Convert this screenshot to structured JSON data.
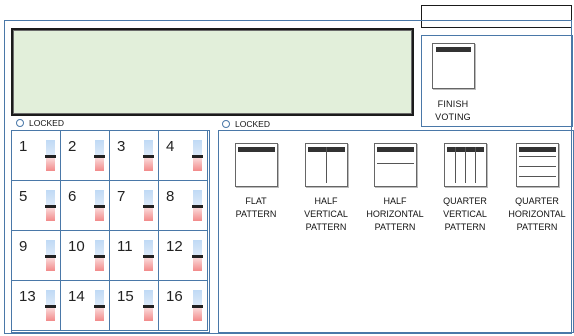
{
  "finish": {
    "label_line1": "FINISH",
    "label_line2": "VOTING"
  },
  "locks": {
    "left_label": "LOCKED",
    "right_label": "LOCKED"
  },
  "cells": [
    {
      "n": "1",
      "level": 0.55
    },
    {
      "n": "2",
      "level": 0.55
    },
    {
      "n": "3",
      "level": 0.55
    },
    {
      "n": "4",
      "level": 0.55
    },
    {
      "n": "5",
      "level": 0.55
    },
    {
      "n": "6",
      "level": 0.55
    },
    {
      "n": "7",
      "level": 0.55
    },
    {
      "n": "8",
      "level": 0.55
    },
    {
      "n": "9",
      "level": 0.55
    },
    {
      "n": "10",
      "level": 0.55
    },
    {
      "n": "11",
      "level": 0.55
    },
    {
      "n": "12",
      "level": 0.55
    },
    {
      "n": "13",
      "level": 0.55
    },
    {
      "n": "14",
      "level": 0.55
    },
    {
      "n": "15",
      "level": 0.55
    },
    {
      "n": "16",
      "level": 0.55
    }
  ],
  "patterns": [
    {
      "l1": "FLAT",
      "l2": "PATTERN",
      "l3": ""
    },
    {
      "l1": "HALF",
      "l2": "VERTICAL",
      "l3": "PATTERN"
    },
    {
      "l1": "HALF",
      "l2": "HORIZONTAL",
      "l3": "PATTERN"
    },
    {
      "l1": "QUARTER",
      "l2": "VERTICAL",
      "l3": "PATTERN"
    },
    {
      "l1": "QUARTER",
      "l2": "HORIZONTAL",
      "l3": "PATTERN"
    }
  ],
  "colors": {
    "accent_border": "#4a78a8",
    "display_bg": "#e2efda",
    "slider_top": "#bfd9f5",
    "slider_bottom": "#f28a8a"
  }
}
